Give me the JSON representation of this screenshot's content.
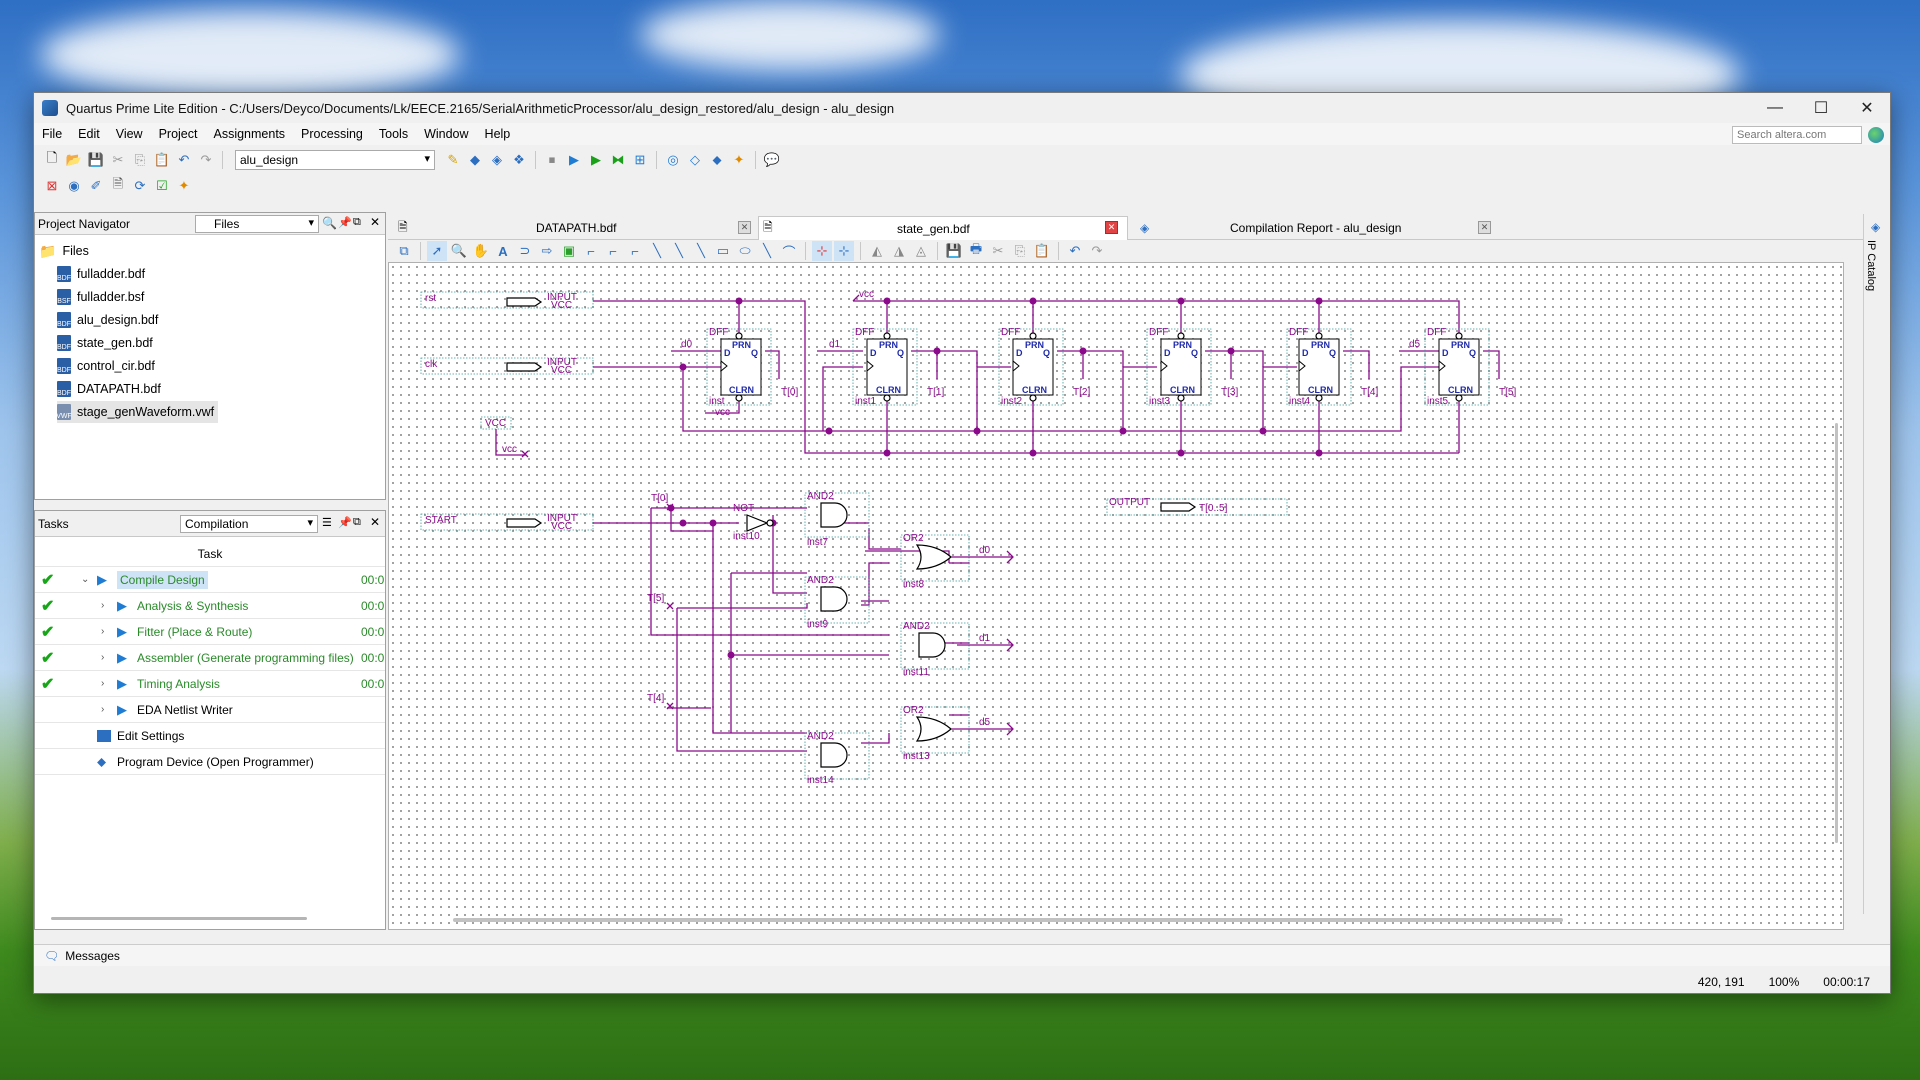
{
  "window": {
    "title": "Quartus Prime Lite Edition - C:/Users/Deyco/Documents/Lk/EECE.2165/SerialArithmeticProcessor/alu_design_restored/alu_design - alu_design"
  },
  "menu": [
    "File",
    "Edit",
    "View",
    "Project",
    "Assignments",
    "Processing",
    "Tools",
    "Window",
    "Help"
  ],
  "search": {
    "placeholder": "Search altera.com"
  },
  "toolbar": {
    "project_select": "alu_design"
  },
  "project_navigator": {
    "title": "Project Navigator",
    "view_select": "Files",
    "root": "Files",
    "files": [
      "fulladder.bdf",
      "fulladder.bsf",
      "alu_design.bdf",
      "state_gen.bdf",
      "control_cir.bdf",
      "DATAPATH.bdf",
      "stage_genWaveform.vwf"
    ]
  },
  "tasks": {
    "title": "Tasks",
    "flow_select": "Compilation",
    "column": "Task",
    "rows": [
      {
        "label": "Compile Design",
        "time": "00:0"
      },
      {
        "label": "Analysis & Synthesis",
        "time": "00:0"
      },
      {
        "label": "Fitter (Place & Route)",
        "time": "00:0"
      },
      {
        "label": "Assembler (Generate programming files)",
        "time": "00:0"
      },
      {
        "label": "Timing Analysis",
        "time": "00:0"
      },
      {
        "label": "EDA Netlist Writer",
        "time": ""
      },
      {
        "label": "Edit Settings",
        "time": ""
      },
      {
        "label": "Program Device (Open Programmer)",
        "time": ""
      }
    ]
  },
  "tabs": [
    "DATAPATH.bdf",
    "state_gen.bdf",
    "Compilation Report - alu_design"
  ],
  "ip_catalog": "IP Catalog",
  "schematic": {
    "pins": {
      "rst": "rst",
      "clk": "clk",
      "start": "START",
      "input": "INPUT",
      "vcc_small": "VCC",
      "vcc": "VCC",
      "vcc_net": "vcc",
      "output": "OUTPUT",
      "out_bus": "T[0..5]"
    },
    "dff": [
      {
        "type": "DFF",
        "inst": "inst",
        "d": "d0",
        "q": "T[0]"
      },
      {
        "type": "DFF",
        "inst": "inst1",
        "d": "d1",
        "q": "T[1]"
      },
      {
        "type": "DFF",
        "inst": "inst2",
        "d": "",
        "q": "T[2]"
      },
      {
        "type": "DFF",
        "inst": "inst3",
        "d": "",
        "q": "T[3]"
      },
      {
        "type": "DFF",
        "inst": "inst4",
        "d": "",
        "q": "T[4]"
      },
      {
        "type": "DFF",
        "inst": "inst5",
        "d": "d5",
        "q": "T[5]"
      }
    ],
    "dff_ports": {
      "d": "D",
      "q": "Q",
      "prn": "PRN",
      "clrn": "CLRN"
    },
    "gates": {
      "not": {
        "type": "NOT",
        "inst": "inst10"
      },
      "and7": {
        "type": "AND2",
        "inst": "inst7"
      },
      "or8": {
        "type": "OR2",
        "inst": "inst8",
        "out": "d0"
      },
      "and9": {
        "type": "AND2",
        "inst": "inst9"
      },
      "and11": {
        "type": "AND2",
        "inst": "inst11",
        "out": "d1"
      },
      "or13": {
        "type": "OR2",
        "inst": "inst13",
        "out": "d5"
      },
      "and14": {
        "type": "AND2",
        "inst": "inst14"
      }
    },
    "nets": {
      "t0": "T[0]",
      "t5": "T[5]",
      "t4": "T[4]",
      "vcc_top": "vcc",
      "vcc_bottom": "vcc"
    }
  },
  "messages": "Messages",
  "status": {
    "coords": "420, 191",
    "zoom": "100%",
    "time": "00:00:17"
  }
}
